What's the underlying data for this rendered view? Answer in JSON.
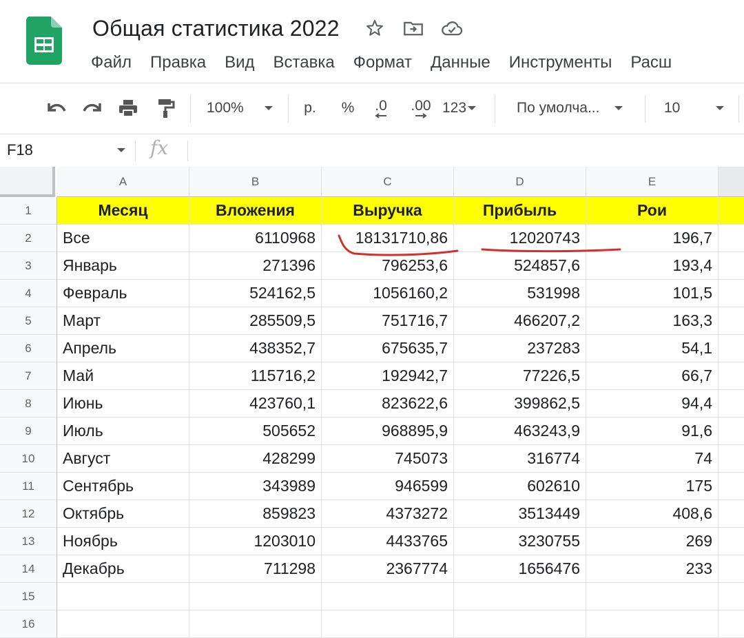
{
  "app": {
    "title": "Общая статистика 2022"
  },
  "icons": {
    "logo": "sheets-logo-icon",
    "star": "star-icon",
    "move": "move-to-folder-icon",
    "cloud": "cloud-saved-icon"
  },
  "menu": [
    "Файл",
    "Правка",
    "Вид",
    "Вставка",
    "Формат",
    "Данные",
    "Инструменты",
    "Расш"
  ],
  "toolbar": {
    "zoom": "100%",
    "currency": "р.",
    "percent": "%",
    "dec_decrease": ".0",
    "dec_increase": ".00",
    "more_formats": "123",
    "font": "По умолча...",
    "font_size": "10"
  },
  "formula_bar": {
    "cell_ref": "F18",
    "fx": "fx",
    "value": ""
  },
  "columns": [
    "A",
    "B",
    "C",
    "D",
    "E"
  ],
  "rows": [
    "1",
    "2",
    "3",
    "4",
    "5",
    "6",
    "7",
    "8",
    "9",
    "10",
    "11",
    "12",
    "13",
    "14",
    "15",
    "16"
  ],
  "table": {
    "headers": [
      "Месяц",
      "Вложения",
      "Выручка",
      "Прибыль",
      "Рои"
    ],
    "body": [
      [
        "Все",
        "6110968",
        "18131710,86",
        "12020743",
        "196,7"
      ],
      [
        "Январь",
        "271396",
        "796253,6",
        "524857,6",
        "193,4"
      ],
      [
        "Февраль",
        "524162,5",
        "1056160,2",
        "531998",
        "101,5"
      ],
      [
        "Март",
        "285509,5",
        "751716,7",
        "466207,2",
        "163,3"
      ],
      [
        "Апрель",
        "438352,7",
        "675635,7",
        "237283",
        "54,1"
      ],
      [
        "Май",
        "115716,2",
        "192942,7",
        "77226,5",
        "66,7"
      ],
      [
        "Июнь",
        "423760,1",
        "823622,6",
        "399862,5",
        "94,4"
      ],
      [
        "Июль",
        "505652",
        "968895,9",
        "463243,9",
        "91,6"
      ],
      [
        "Август",
        "428299",
        "745073",
        "316774",
        "74"
      ],
      [
        "Сентябрь",
        "343989",
        "946599",
        "602610",
        "175"
      ],
      [
        "Октябрь",
        "859823",
        "4373272",
        "3513449",
        "408,6"
      ],
      [
        "Ноябрь",
        "1203010",
        "4433765",
        "3230755",
        "269"
      ],
      [
        "Декабрь",
        "711298",
        "2367774",
        "1656476",
        "233"
      ],
      [
        "",
        "",
        "",
        "",
        ""
      ],
      [
        "",
        "",
        "",
        "",
        ""
      ]
    ]
  },
  "colors": {
    "header_fill": "#ffff00",
    "annotation": "#d0312d",
    "sheets_green": "#1fa463"
  }
}
